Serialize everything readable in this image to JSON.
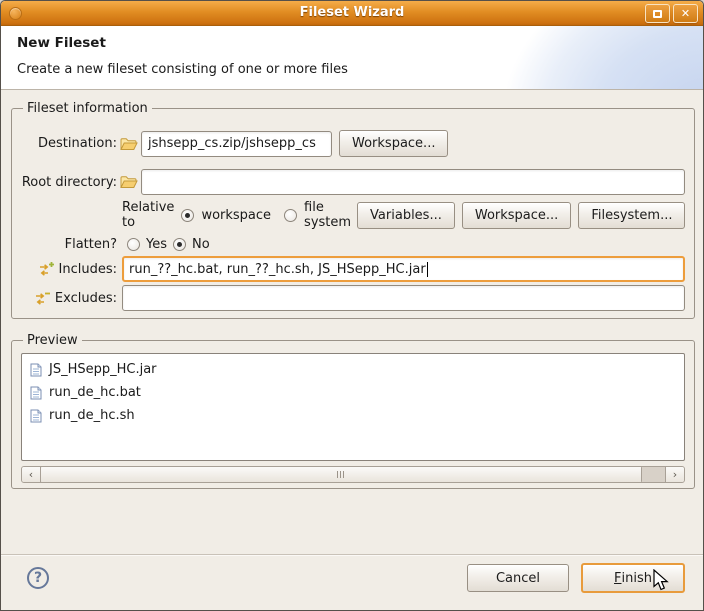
{
  "window": {
    "title": "Fileset Wizard"
  },
  "icons": {
    "close": "✕",
    "maximize": "maximize-square",
    "window_menu": "window-menu-dot",
    "help": "?",
    "scroll_left": "‹",
    "scroll_right": "›",
    "destination": "folder-open-icon",
    "root_directory": "folder-open-icon",
    "includes": "includes-filter-icon",
    "excludes": "excludes-filter-icon",
    "file": "text-file-icon"
  },
  "header": {
    "title": "New Fileset",
    "description": "Create a new fileset consisting of one or more files"
  },
  "fileset_info": {
    "legend": "Fileset information",
    "destination_label": "Destination:",
    "destination_value": "jshsepp_cs.zip/jshsepp_cs",
    "destination_button": "Workspace...",
    "root_label": "Root directory:",
    "root_value": "",
    "relative_label": "Relative to",
    "relative_options": [
      {
        "label": "workspace",
        "selected": true
      },
      {
        "label": "file system",
        "selected": false
      }
    ],
    "relative_buttons": [
      "Variables...",
      "Workspace...",
      "Filesystem..."
    ],
    "flatten_label": "Flatten?",
    "flatten_options": [
      {
        "label": "Yes",
        "selected": false
      },
      {
        "label": "No",
        "selected": true
      }
    ],
    "includes_label": "Includes:",
    "includes_value": "run_??_hc.bat, run_??_hc.sh, JS_HSepp_HC.jar",
    "excludes_label": "Excludes:",
    "excludes_value": ""
  },
  "preview": {
    "legend": "Preview",
    "files": [
      "JS_HSepp_HC.jar",
      "run_de_hc.bat",
      "run_de_hc.sh"
    ]
  },
  "footer": {
    "cancel_label": "Cancel",
    "finish_key": "F",
    "finish_rest": "inish"
  },
  "colors": {
    "titlebar_orange": "#e18d23",
    "focus_orange": "#ed9d3c",
    "body_bg": "#f1ede6",
    "banner_blue": "#c3d2ee",
    "help_blue": "#66789a"
  }
}
